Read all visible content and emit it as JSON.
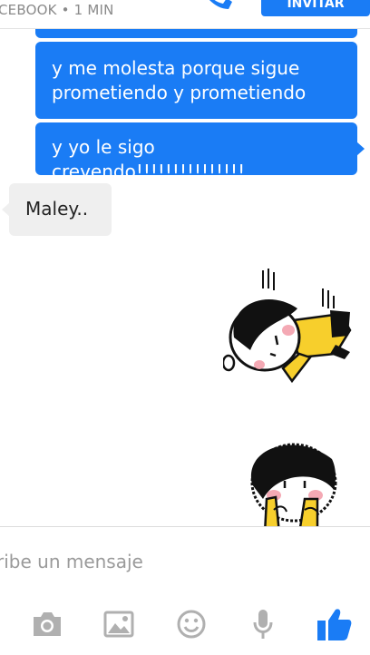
{
  "header": {
    "subtitle": "CEBOOK • 1 MIN",
    "invite_label": "INVITAR"
  },
  "messages": [
    {
      "side": "out",
      "text": "y me molesta porque sigue prometiendo y prometiendo"
    },
    {
      "side": "out",
      "text": "y yo le sigo creyendo!!!!!!!!!!!!!!!"
    },
    {
      "side": "in",
      "text": "Maley.."
    }
  ],
  "composer": {
    "placeholder": "ribe un mensaje"
  },
  "toolbar": {
    "items": [
      "camera",
      "image",
      "emoji",
      "microphone",
      "like"
    ]
  },
  "colors": {
    "accent": "#1a7cf5",
    "incoming_bubble": "#efefef"
  }
}
